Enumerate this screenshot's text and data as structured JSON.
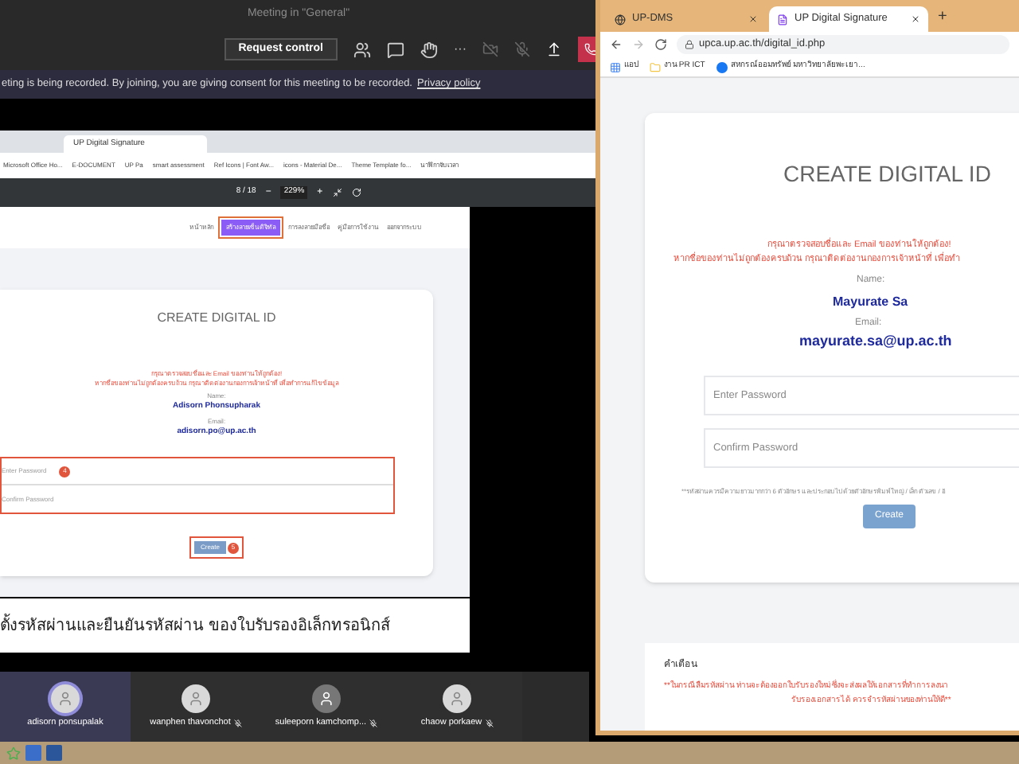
{
  "meeting": {
    "title": "Meeting in \"General\"",
    "request_control": "Request control",
    "more": "···",
    "banner": "eting is being recorded. By joining, you are giving consent for this meeting to be recorded.",
    "banner_link": "Privacy policy"
  },
  "shared": {
    "tabs": [
      {
        "label": "UP Digital Signature",
        "selected": true
      }
    ],
    "bookmarks": [
      "Microsoft Office Ho...",
      "E-DOCUMENT",
      "UP Pa",
      "smart assessment",
      "Ref Icons | Font Aw...",
      "icons - Material De...",
      "Theme Template fo...",
      "นาฬิกาจับเวลา"
    ],
    "pdf_page": "8 / 18",
    "pdf_zoom": "229%",
    "pdf_minus": "−",
    "pdf_plus": "+",
    "nav": [
      {
        "label": "หน้าหลัก",
        "selected": false
      },
      {
        "label": "สร้างลายเซ็นดิจิทัล",
        "selected": true
      },
      {
        "label": "การลงลายมือชื่อ",
        "selected": false
      },
      {
        "label": "คู่มือการใช้งาน",
        "selected": false
      },
      {
        "label": "ออกจากระบบ",
        "selected": false
      }
    ],
    "card_title": "CREATE DIGITAL ID",
    "notice": [
      "กรุณาตรวจสอบชื่อและ Email ของท่านให้ถูกต้อง!",
      "หากชื่อของท่านไม่ถูกต้องครบถ้วน กรุณาติดต่องานกองการเจ้าหน้าที่ เพื่อทำการแก้ไขข้อมูล"
    ],
    "name_label": "Name:",
    "name": "Adisorn Phonsupharak",
    "email_label": "Email:",
    "email": "adisorn.po@up.ac.th",
    "password_placeholder": "Enter Password",
    "confirm_placeholder": "Confirm Password",
    "step_password": "4",
    "create": "Create",
    "step_create": "5",
    "caption": "ตั้งรหัสผ่านและยืนยันรหัสผ่าน ของใบรับรองอิเล็กทรอนิกส์"
  },
  "participants": [
    {
      "name": "adisorn ponsupalak",
      "speaking": true,
      "muted": false,
      "kind": "photo"
    },
    {
      "name": "wanphen thavonchot",
      "speaking": false,
      "muted": true,
      "kind": "photo"
    },
    {
      "name": "suleeporn kamchomp...",
      "speaking": false,
      "muted": true,
      "kind": "generic"
    },
    {
      "name": "chaow porkaew",
      "speaking": false,
      "muted": true,
      "kind": "photo"
    }
  ],
  "browser": {
    "tabs": [
      {
        "label": "UP-DMS",
        "selected": false
      },
      {
        "label": "UP Digital Signature",
        "selected": true
      }
    ],
    "new_tab": "+",
    "url": "upca.up.ac.th/digital_id.php",
    "bookmarks": [
      {
        "label": "แอป",
        "kind": "apps"
      },
      {
        "label": "งาน PR ICT",
        "kind": "folder"
      },
      {
        "label": "สหกรณ์ออมทรัพย์ มหาวิทยาลัยพะเยา...",
        "kind": "facebook"
      }
    ]
  },
  "page": {
    "title": "CREATE DIGITAL ID",
    "notice": [
      "กรุณาตรวจสอบชื่อและ Email ของท่านให้ถูกต้อง!",
      "หากชื่อของท่านไม่ถูกต้องครบถ้วน กรุณาติดต่องานกองการเจ้าหน้าที่ เพื่อทำ"
    ],
    "name_label": "Name:",
    "name": "Mayurate Sa",
    "email_label": "Email:",
    "email": "mayurate.sa@up.ac.th",
    "password_placeholder": "Enter Password",
    "confirm_placeholder": "Confirm Password",
    "hint": "**รหัสผ่านควรมีความยาวมากกว่า 6 ตัวอักษร และประกอบไปด้วยตัวอักษรพิมพ์ใหญ่ / เล็ก ตัวเลข / อั",
    "create": "Create",
    "warning_title": "คำเตือน",
    "warning": [
      "**ในกรณีลืมรหัสผ่าน ท่านจะต้องออกใบรับรองใหม่ ซึ่งจะส่งผลให้เอกสารที่ทำการลงนา",
      "รับรองเอกสารได้ ควรจำรหัสผ่านของท่านให้ดี**"
    ]
  }
}
